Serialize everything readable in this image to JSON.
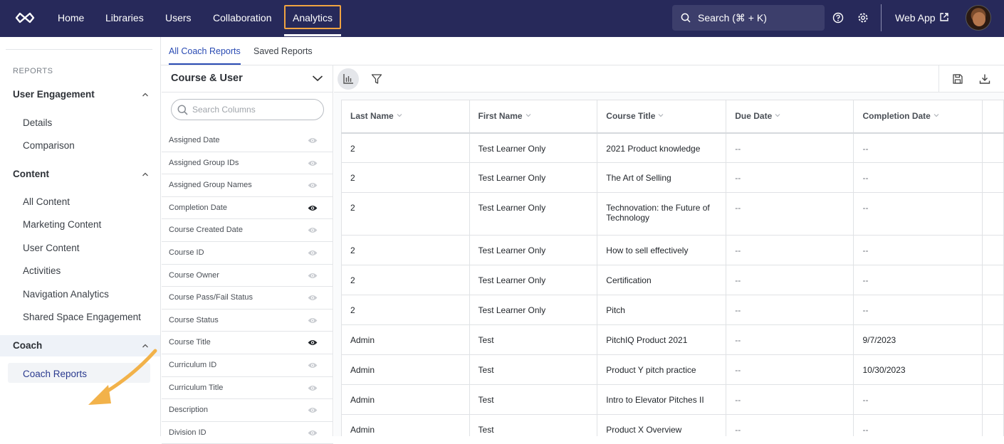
{
  "topnav": {
    "logo_icon": "infinity-logo-icon",
    "links": [
      "Home",
      "Libraries",
      "Users",
      "Collaboration",
      "Analytics"
    ],
    "active_link": "Analytics",
    "search_placeholder": "Search (⌘ + K)",
    "web_app_label": "Web App",
    "accent_color": "#f0a341",
    "bg_color": "#27295a"
  },
  "sidebar": {
    "caption": "REPORTS",
    "groups": [
      {
        "label": "User Engagement",
        "items": [
          "Details",
          "Comparison"
        ]
      },
      {
        "label": "Content",
        "items": [
          "All Content",
          "Marketing Content",
          "User Content",
          "Activities",
          "Navigation Analytics",
          "Shared Space Engagement"
        ]
      },
      {
        "label": "Coach",
        "items": [
          "Coach Reports"
        ]
      }
    ],
    "active_item": "Coach Reports"
  },
  "tabs": [
    "All Coach Reports",
    "Saved Reports"
  ],
  "active_tab": "All Coach Reports",
  "column_panel": {
    "title": "Course & User",
    "search_placeholder": "Search Columns",
    "columns": [
      {
        "label": "Assigned Date",
        "visible": false
      },
      {
        "label": "Assigned Group IDs",
        "visible": false
      },
      {
        "label": "Assigned Group Names",
        "visible": false
      },
      {
        "label": "Completion Date",
        "visible": true
      },
      {
        "label": "Course Created Date",
        "visible": false
      },
      {
        "label": "Course ID",
        "visible": false
      },
      {
        "label": "Course Owner",
        "visible": false
      },
      {
        "label": "Course Pass/Fail Status",
        "visible": false
      },
      {
        "label": "Course Status",
        "visible": false
      },
      {
        "label": "Course Title",
        "visible": true
      },
      {
        "label": "Curriculum ID",
        "visible": false
      },
      {
        "label": "Curriculum Title",
        "visible": false
      },
      {
        "label": "Description",
        "visible": false
      },
      {
        "label": "Division ID",
        "visible": false
      }
    ]
  },
  "table": {
    "headers": [
      "Last Name",
      "First Name",
      "Course Title",
      "Due Date",
      "Completion Date"
    ],
    "rows": [
      [
        "2",
        "Test Learner Only",
        "2021 Product knowledge",
        "--",
        "--"
      ],
      [
        "2",
        "Test Learner Only",
        "The Art of Selling",
        "--",
        "--"
      ],
      [
        "2",
        "Test Learner Only",
        "Technovation: the Future of Technology",
        "--",
        "--"
      ],
      [
        "2",
        "Test Learner Only",
        "How to sell effectively",
        "--",
        "--"
      ],
      [
        "2",
        "Test Learner Only",
        "Certification",
        "--",
        "--"
      ],
      [
        "2",
        "Test Learner Only",
        "Pitch",
        "--",
        "--"
      ],
      [
        "Admin",
        "Test",
        "PitchIQ Product 2021",
        "--",
        "9/7/2023"
      ],
      [
        "Admin",
        "Test",
        "Product Y pitch practice",
        "--",
        "10/30/2023"
      ],
      [
        "Admin",
        "Test",
        "Intro to Elevator Pitches II",
        "--",
        "--"
      ],
      [
        "Admin",
        "Test",
        "Product X Overview",
        "--",
        "--"
      ]
    ]
  }
}
